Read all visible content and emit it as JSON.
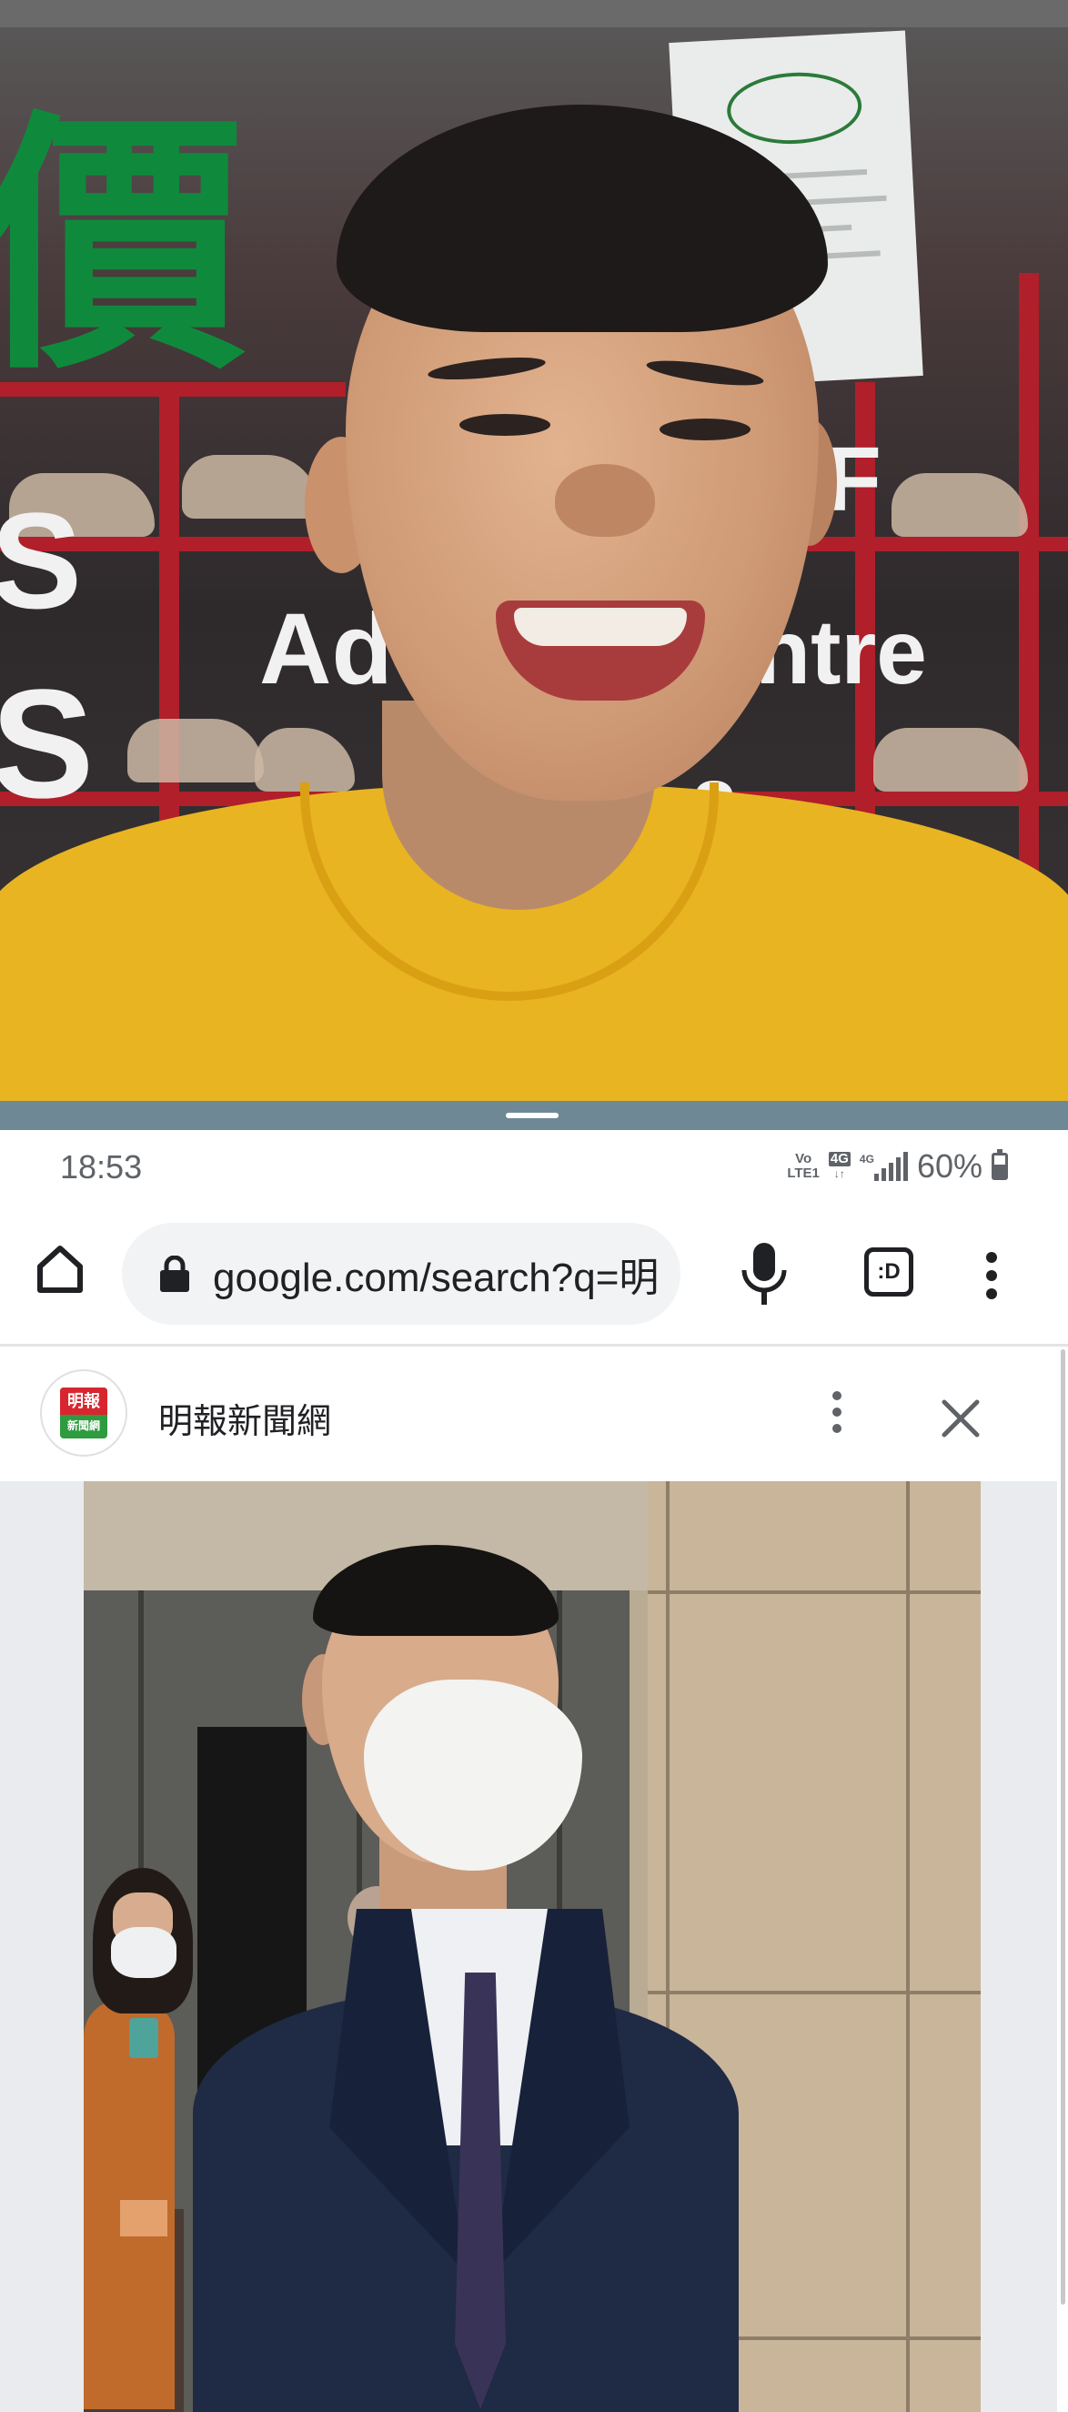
{
  "status_bar": {
    "time": "18:53",
    "volte_top": "Vo",
    "volte_bottom": "LTE1",
    "network_badge_1": "4G",
    "network_badge_2": "4G",
    "battery_percent": "60%",
    "battery_level": 0.6
  },
  "browser": {
    "url": "google.com/search?q=明",
    "tab_switcher_label": ":D"
  },
  "source": {
    "name": "明報新聞網",
    "favicon_top": "明報",
    "favicon_bottom": "新聞網"
  },
  "top_photo": {
    "sign_char": "價",
    "glass_text_1": "/F",
    "glass_text_2": "Ad",
    "glass_text_3": "ntre",
    "glass_text_4": "r 2",
    "glass_text_5": "S",
    "glass_text_6": "S"
  },
  "icons": {
    "home": "home-icon",
    "lock": "lock-icon",
    "mic": "mic-icon",
    "tabs": "tabs-icon",
    "menu": "more-vert-icon",
    "close": "close-icon"
  },
  "colors": {
    "divider": "#6e8896",
    "omnibox_bg": "#f1f3f4",
    "shirt": "#e8b421",
    "suit": "#1f2a44"
  }
}
